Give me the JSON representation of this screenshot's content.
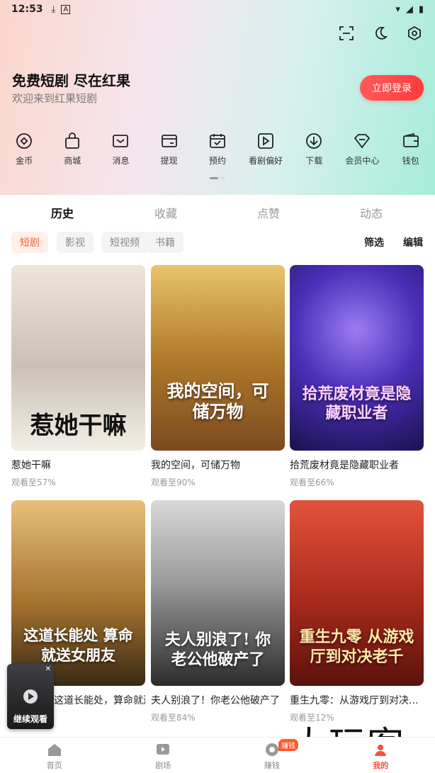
{
  "status_bar": {
    "time": "12:53",
    "icons": [
      "download-icon",
      "a-icon"
    ],
    "right": [
      "wifi-icon",
      "signal-icon",
      "battery-icon"
    ]
  },
  "header": {
    "title": "免费短剧 尽在红果",
    "subtitle": "欢迎来到红果短剧",
    "login_button": "立即登录",
    "top_icons": [
      "scan-icon",
      "night-mode-icon",
      "settings-icon"
    ]
  },
  "quick_menu": [
    {
      "label": "金币",
      "icon": "coin-icon"
    },
    {
      "label": "商城",
      "icon": "shopping-bag-icon"
    },
    {
      "label": "消息",
      "icon": "message-icon"
    },
    {
      "label": "提现",
      "icon": "wallet-card-icon"
    },
    {
      "label": "预约",
      "icon": "calendar-icon"
    },
    {
      "label": "看剧偏好",
      "icon": "play-square-icon"
    },
    {
      "label": "下载",
      "icon": "download-circle-icon"
    },
    {
      "label": "会员中心",
      "icon": "diamond-icon"
    },
    {
      "label": "钱包",
      "icon": "wallet-icon"
    }
  ],
  "tabs": [
    {
      "label": "历史",
      "active": true
    },
    {
      "label": "收藏",
      "active": false
    },
    {
      "label": "点赞",
      "active": false
    },
    {
      "label": "动态",
      "active": false
    }
  ],
  "filters": {
    "chips": [
      {
        "label": "短剧",
        "active": true
      },
      {
        "label": "影视",
        "active": false
      },
      {
        "label": "短视频",
        "active": false
      },
      {
        "label": "书籍",
        "active": false
      }
    ],
    "filter_label": "筛选",
    "edit_label": "编辑"
  },
  "cards": [
    {
      "title": "惹她干嘛",
      "progress": "观看至57%",
      "poster_text": "惹她干嘛",
      "colors": [
        "#e9e2d4",
        "#2b2b2b"
      ]
    },
    {
      "title": "我的空间，可储万物",
      "progress": "观看至90%",
      "poster_text": "我的空间，可储万物",
      "colors": [
        "#caa24c",
        "#6b3f1e"
      ]
    },
    {
      "title": "拾荒废材竟是隐藏职业者",
      "progress": "观看至66%",
      "poster_text": "拾荒废材竟是隐藏职业者",
      "colors": [
        "#5a3cc9",
        "#1d1550"
      ]
    },
    {
      "title": "这道长能处，算命就送女朋友",
      "progress": "",
      "poster_text": "这道长能处 算命就送女朋友",
      "colors": [
        "#d9a74a",
        "#3a2a14"
      ]
    },
    {
      "title": "夫人别浪了！你老公他破产了",
      "progress": "观看至84%",
      "poster_text": "夫人别浪了! 你老公他破产了",
      "colors": [
        "#cfcfcf",
        "#333333"
      ]
    },
    {
      "title": "重生九零：从游戏厅到对决...",
      "progress": "观看至12%",
      "poster_text": "重生九零 从游戏厅到对决老千",
      "colors": [
        "#d83a2b",
        "#5a120c"
      ]
    }
  ],
  "continue_watching": {
    "label": "继续观看"
  },
  "bottom_nav": [
    {
      "label": "首页",
      "icon": "home-icon",
      "active": false
    },
    {
      "label": "剧场",
      "icon": "theater-icon",
      "active": false
    },
    {
      "label": "赚钱",
      "icon": "earn-coin-icon",
      "active": false,
      "badge": "赚钱"
    },
    {
      "label": "我的",
      "icon": "profile-icon",
      "active": true
    }
  ],
  "watermark": "大玩客",
  "accent_color": "#ff4b3b"
}
